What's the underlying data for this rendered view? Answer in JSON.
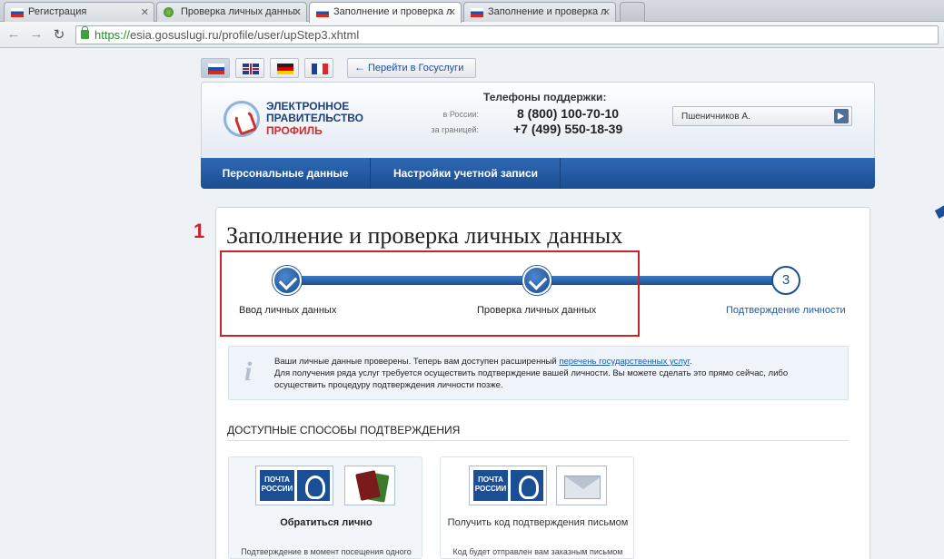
{
  "browser": {
    "tabs": [
      {
        "label": "Регистрация",
        "active": false
      },
      {
        "label": "Проверка личных данных",
        "active": false
      },
      {
        "label": "Заполнение и проверка л",
        "active": true
      },
      {
        "label": "Заполнение и проверка л",
        "active": false
      }
    ],
    "url_scheme": "https://",
    "url_rest": "esia.gosuslugi.ru/profile/user/upStep3.xhtml"
  },
  "header": {
    "goto_gosuslugi": "Перейти в Госуслуги",
    "logo_line1": "ЭЛЕКТРОННОЕ",
    "logo_line2": "ПРАВИТЕЛЬСТВО",
    "logo_line3": "ПРОФИЛЬ",
    "phones_title": "Телефоны поддержки:",
    "phone_ru_label": "в России:",
    "phone_ru": "8 (800) 100-70-10",
    "phone_abroad_label": "за границей:",
    "phone_abroad": "+7 (499) 550-18-39",
    "user_name": "Пшеничников А."
  },
  "menu": {
    "personal": "Персональные данные",
    "settings": "Настройки учетной записи"
  },
  "main": {
    "step_mark": "1",
    "title": "Заполнение и проверка личных данных",
    "steps": [
      {
        "label": "Ввод личных данных",
        "state": "done"
      },
      {
        "label": "Проверка личных данных",
        "state": "done"
      },
      {
        "label": "Подтверждение личности",
        "state": "todo",
        "number": "3"
      }
    ],
    "info_line1_pre": "Ваши личные данные проверены. Теперь вам доступен расширенный ",
    "info_link": "перечень государственных услуг",
    "info_line1_post": ".",
    "info_line2": "Для получения ряда услуг требуется осуществить подтверждение вашей личности. Вы можете сделать это прямо сейчас, либо осуществить процедуру подтверждения личности позже.",
    "section_title": "ДОСТУПНЫЕ СПОСОБЫ ПОДТВЕРЖДЕНИЯ",
    "methods": [
      {
        "title": "Обратиться лично",
        "desc": "Подтверждение в момент посещения одного"
      },
      {
        "title": "Получить код подтверждения письмом",
        "desc": "Код будет отправлен вам заказным письмом"
      }
    ],
    "pochta_text": "ПОЧТА РОССИИ"
  }
}
